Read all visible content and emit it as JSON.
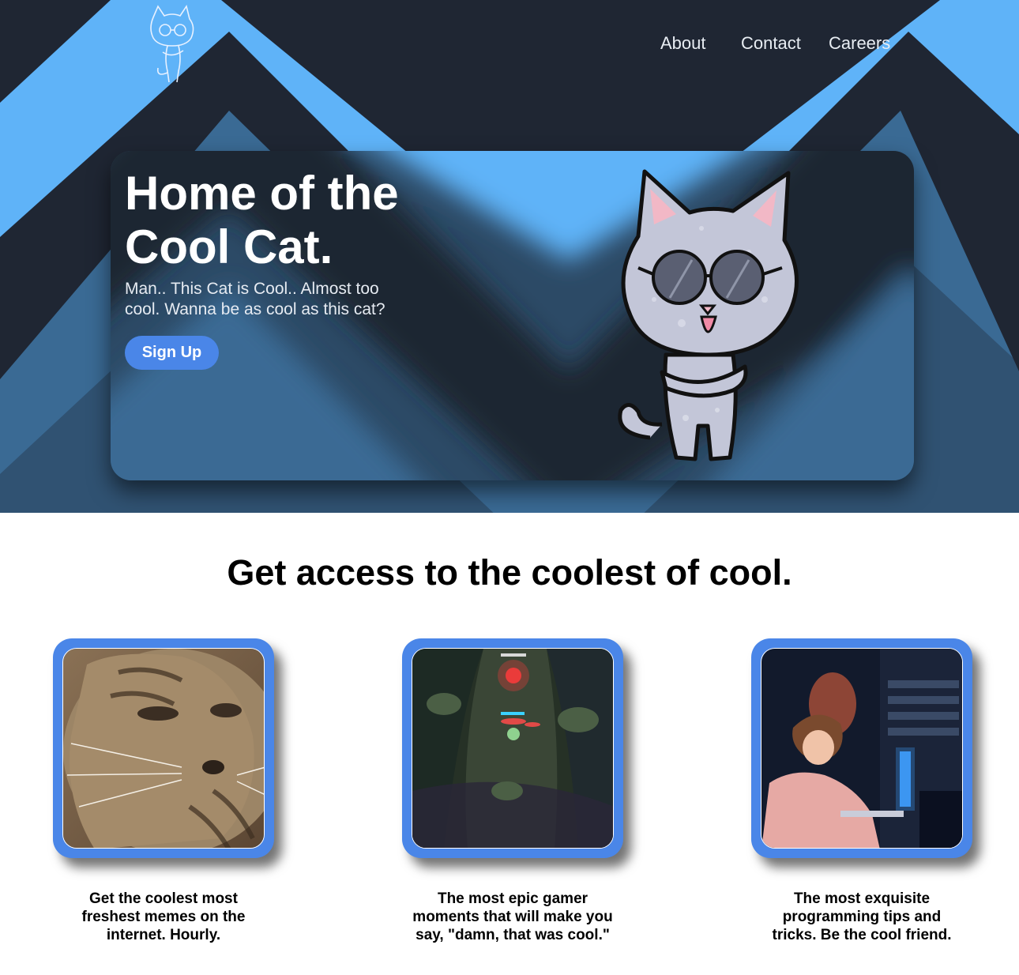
{
  "nav": {
    "logo_icon": "cool-cat-logo-icon",
    "links": [
      "About",
      "Contact",
      "Careers"
    ]
  },
  "hero": {
    "title": "Home of the Cool Cat.",
    "subtitle": "Man.. This Cat is Cool.. Almost too cool. Wanna be as cool as this cat?",
    "cta_label": "Sign Up",
    "mascot_icon": "cool-cat-sunglasses-icon"
  },
  "features": {
    "heading": "Get access to the coolest of cool.",
    "items": [
      {
        "image": "cat-meme-image",
        "caption": "Get the coolest most freshest memes on the internet. Hourly."
      },
      {
        "image": "gamer-moment-image",
        "caption": "The most epic gamer moments that will make you say, \"damn, that was cool.\""
      },
      {
        "image": "programmer-anime-image",
        "caption": "The most exquisite programming tips and tricks. Be the cool friend."
      }
    ]
  },
  "colors": {
    "light_blue": "#5fb3f8",
    "dark_navy": "#1f2633",
    "mid_blue": "#3a6a94",
    "accent": "#4a86e8",
    "background": "#ffffff"
  }
}
